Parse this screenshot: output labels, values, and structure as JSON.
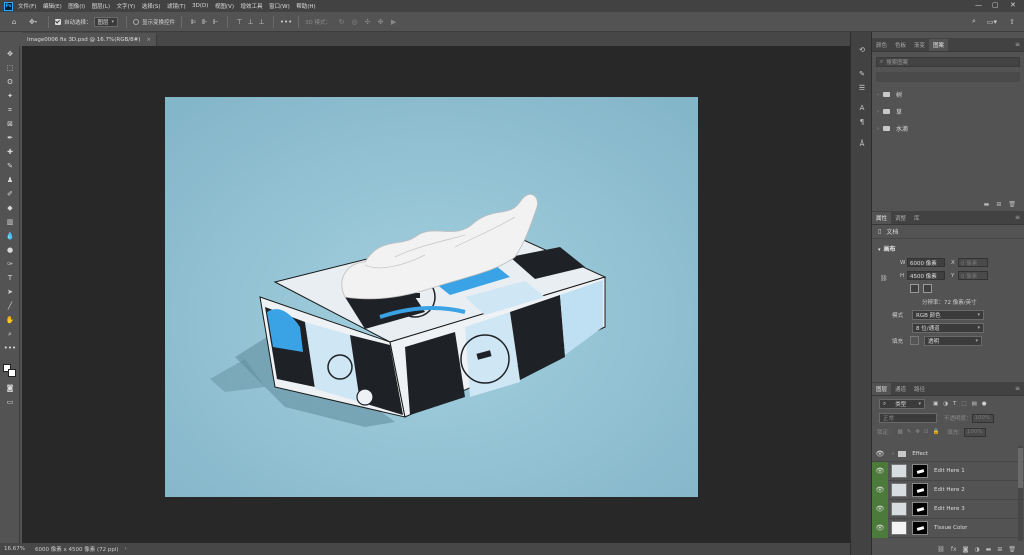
{
  "menubar": {
    "items": [
      "文件(F)",
      "编辑(E)",
      "图像(I)",
      "图层(L)",
      "文字(Y)",
      "选择(S)",
      "滤镜(T)",
      "3D(D)",
      "视图(V)",
      "增效工具",
      "窗口(W)",
      "帮助(H)"
    ]
  },
  "options": {
    "auto_select_label": "自动选择：",
    "auto_select_value": "图层",
    "show_transform_label": "显示变换控件",
    "mode_3d_label": "3D 模式："
  },
  "document": {
    "tab_title": "Image0006 fix 3D.psd @ 16.7%(RGB/8#)",
    "close": "×"
  },
  "status": {
    "zoom": "16.67%",
    "size": "6000 像素 x 4500 像素 (72 ppi)"
  },
  "library_panel": {
    "tabs": [
      "颜色",
      "色板",
      "渐变",
      "图案"
    ],
    "active_tab": "图案",
    "search_placeholder": "搜索图案",
    "items": [
      "树",
      "草",
      "水滴"
    ]
  },
  "properties_panel": {
    "tabs": [
      "属性",
      "调整",
      "库"
    ],
    "active_tab": "属性",
    "doc_label": "文档",
    "canvas_heading": "画布",
    "w_label": "W",
    "w_value": "6000 像素",
    "h_label": "H",
    "h_value": "4500 像素",
    "x_label": "X",
    "x_value": "0 像素",
    "y_label": "Y",
    "y_value": "0 像素",
    "resolution": "分辨率：72 像素/英寸",
    "mode_label": "模式",
    "mode_value": "RGB 颜色",
    "depth_value": "8 位/通道",
    "fill_label": "填充",
    "fill_value": "透明"
  },
  "layers_panel": {
    "tabs": [
      "图层",
      "通道",
      "路径"
    ],
    "active_tab": "图层",
    "kind_filter": "类型",
    "blend_mode": "正常",
    "opacity_label": "不透明度：",
    "opacity_value": "100%",
    "lock_label": "锁定：",
    "fill_label": "填充：",
    "fill_value": "100%",
    "layers": [
      {
        "name": "Effect",
        "type": "group"
      },
      {
        "name": "Edit Here 1",
        "type": "smart"
      },
      {
        "name": "Edit Here 2",
        "type": "smart"
      },
      {
        "name": "Edit Here 3",
        "type": "smart"
      },
      {
        "name": "Tissue Color",
        "type": "fill"
      }
    ]
  },
  "colors": {
    "canvas_bg": "#8fbfd0",
    "pattern_blue": "#3aa3e6",
    "layer_eye_green": "#4c7a3a"
  }
}
